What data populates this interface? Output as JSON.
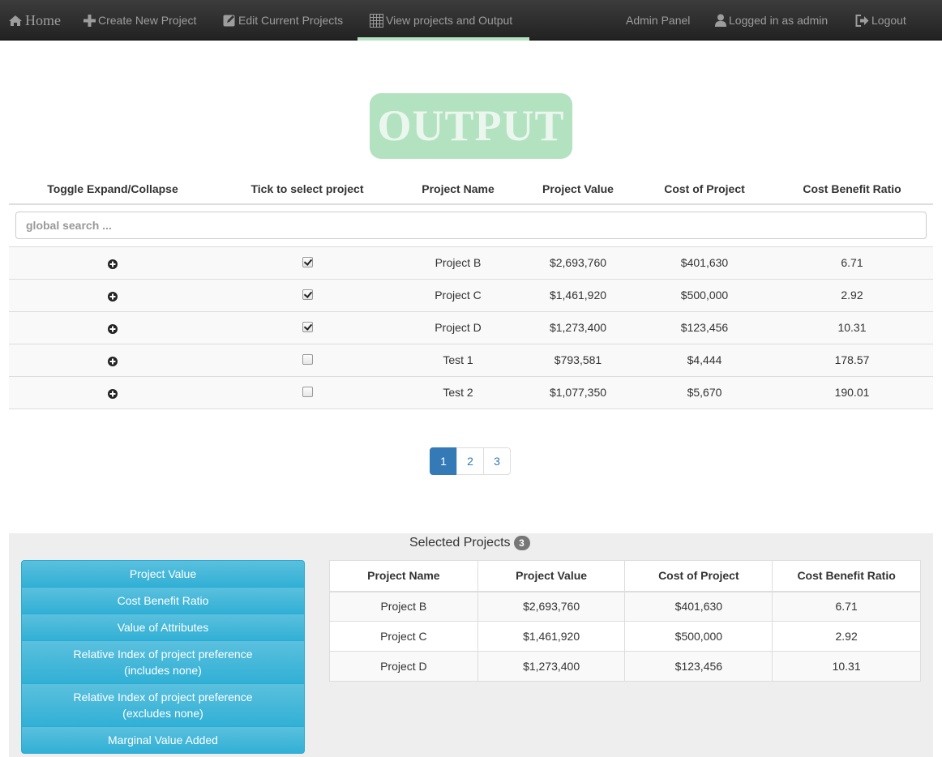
{
  "nav": {
    "home": "Home",
    "create": "Create New Project",
    "edit": "Edit Current Projects",
    "view": "View projects and Output",
    "admin": "Admin Panel",
    "logged": "Logged in as admin",
    "logout": "Logout",
    "active_color": "#b5e3c0"
  },
  "output_title": "OUTPUT",
  "table": {
    "headers": [
      "Toggle Expand/Collapse",
      "Tick to select project",
      "Project Name",
      "Project Value",
      "Cost of Project",
      "Cost Benefit Ratio"
    ],
    "search_placeholder": "global search ...",
    "rows": [
      {
        "checked": true,
        "name": "Project B",
        "value": "$2,693,760",
        "cost": "$401,630",
        "ratio": "6.71"
      },
      {
        "checked": true,
        "name": "Project C",
        "value": "$1,461,920",
        "cost": "$500,000",
        "ratio": "2.92"
      },
      {
        "checked": true,
        "name": "Project D",
        "value": "$1,273,400",
        "cost": "$123,456",
        "ratio": "10.31"
      },
      {
        "checked": false,
        "name": "Test 1",
        "value": "$793,581",
        "cost": "$4,444",
        "ratio": "178.57"
      },
      {
        "checked": false,
        "name": "Test 2",
        "value": "$1,077,350",
        "cost": "$5,670",
        "ratio": "190.01"
      }
    ]
  },
  "pagination": {
    "pages": [
      "1",
      "2",
      "3"
    ],
    "current": "1"
  },
  "selected": {
    "title": "Selected Projects",
    "count": "3",
    "buttons": [
      "Project Value",
      "Cost Benefit Ratio",
      "Value of Attributes",
      "Relative Index of project preference\n(includes none)",
      "Relative Index of project preference\n(excludes none)",
      "Marginal Value Added"
    ],
    "headers": [
      "Project Name",
      "Project Value",
      "Cost of Project",
      "Cost Benefit Ratio"
    ],
    "rows": [
      {
        "name": "Project B",
        "value": "$2,693,760",
        "cost": "$401,630",
        "ratio": "6.71"
      },
      {
        "name": "Project C",
        "value": "$1,461,920",
        "cost": "$500,000",
        "ratio": "2.92"
      },
      {
        "name": "Project D",
        "value": "$1,273,400",
        "cost": "$123,456",
        "ratio": "10.31"
      }
    ]
  }
}
